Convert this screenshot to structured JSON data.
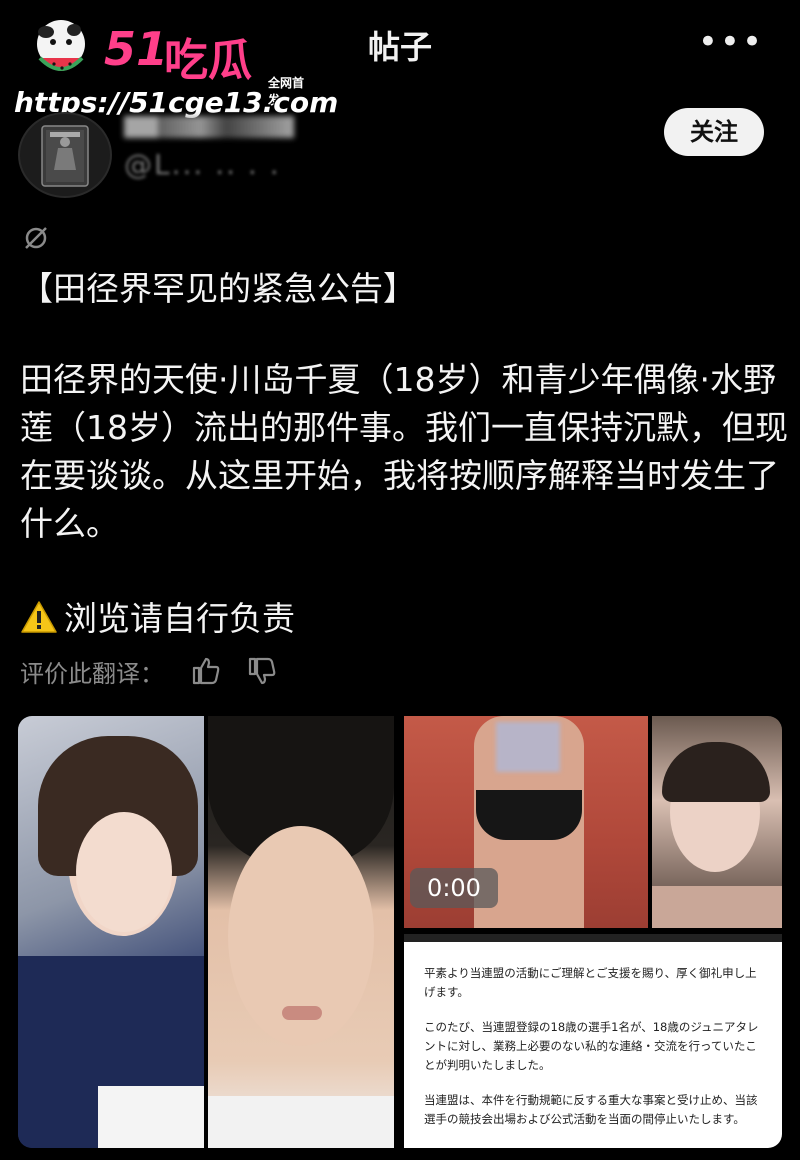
{
  "header": {
    "title": "帖子",
    "more_label": "•••"
  },
  "watermark": {
    "logo_number": "51",
    "logo_text": "吃瓜",
    "tagline": "全网首发",
    "url": "https://51cge13.com"
  },
  "author": {
    "handle": "@L... .. . .",
    "follow_label": "关注"
  },
  "post": {
    "heading": "【田径界罕见的紧急公告】",
    "body": "田径界的天使·川岛千夏（18岁）和青少年偶像·水野莲（18岁）流出的那件事。我们一直保持沉默，但现在要谈谈。从这里开始，我将按顺序解释当时发生了什么。",
    "warning": "浏览请自行负责",
    "rate_label": "评价此翻译："
  },
  "media": {
    "video_time": "0:00",
    "document_paragraphs": [
      "平素より当連盟の活動にご理解とご支援を賜り、厚く御礼申し上げます。",
      "このたび、当連盟登録の18歳の選手1名が、18歳のジュニアタレントに対し、業務上必要のない私的な連絡・交流を行っていたことが判明いたしました。",
      "当連盟は、本件を行動規範に反する重大な事案と受け止め、当該選手の競技会出場および公式活動を当面の間停止いたします。"
    ]
  },
  "icons": {
    "more": "more-horizontal-icon",
    "no_entry": "no-entry-icon",
    "warning": "warning-icon",
    "thumbs_up": "thumbs-up-icon",
    "thumbs_down": "thumbs-down-icon"
  },
  "colors": {
    "background": "#000000",
    "logo_pink": "#ff3f8a",
    "follow_bg": "#f2f2f2"
  }
}
